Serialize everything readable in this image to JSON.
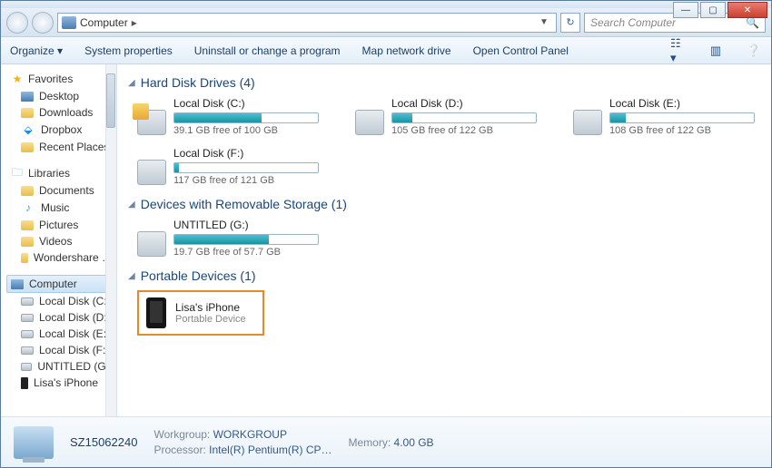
{
  "window_controls": {
    "min": "—",
    "max": "▢",
    "close": "✕"
  },
  "address": {
    "location": "Computer",
    "dropdown": "▼",
    "refresh": "↻"
  },
  "search": {
    "placeholder": "Search Computer"
  },
  "toolbar": {
    "organize": "Organize ▾",
    "system_properties": "System properties",
    "uninstall": "Uninstall or change a program",
    "map_drive": "Map network drive",
    "control_panel": "Open Control Panel"
  },
  "sidebar": {
    "favorites": {
      "label": "Favorites",
      "items": [
        "Desktop",
        "Downloads",
        "Dropbox",
        "Recent Places"
      ]
    },
    "libraries": {
      "label": "Libraries",
      "items": [
        "Documents",
        "Music",
        "Pictures",
        "Videos",
        "Wondershare …"
      ]
    },
    "computer": {
      "label": "Computer",
      "items": [
        "Local Disk (C:)",
        "Local Disk (D:)",
        "Local Disk (E:)",
        "Local Disk (F:)",
        "UNTITLED (G:)",
        "Lisa's iPhone"
      ]
    }
  },
  "sections": {
    "hdd": {
      "title": "Hard Disk Drives (4)",
      "drives": [
        {
          "name": "Local Disk (C:)",
          "free": "39.1 GB free of 100 GB",
          "used_pct": 61
        },
        {
          "name": "Local Disk (D:)",
          "free": "105 GB free of 122 GB",
          "used_pct": 14
        },
        {
          "name": "Local Disk (E:)",
          "free": "108 GB free of 122 GB",
          "used_pct": 11
        },
        {
          "name": "Local Disk (F:)",
          "free": "117 GB free of 121 GB",
          "used_pct": 3
        }
      ]
    },
    "removable": {
      "title": "Devices with Removable Storage (1)",
      "drives": [
        {
          "name": "UNTITLED (G:)",
          "free": "19.7 GB free of 57.7 GB",
          "used_pct": 66
        }
      ]
    },
    "portable": {
      "title": "Portable Devices (1)",
      "device": {
        "name": "Lisa's iPhone",
        "type": "Portable Device"
      }
    }
  },
  "status": {
    "computer_name": "SZ15062240",
    "workgroup_label": "Workgroup:",
    "workgroup": "WORKGROUP",
    "processor_label": "Processor:",
    "processor": "Intel(R) Pentium(R) CP…",
    "memory_label": "Memory:",
    "memory": "4.00 GB"
  }
}
